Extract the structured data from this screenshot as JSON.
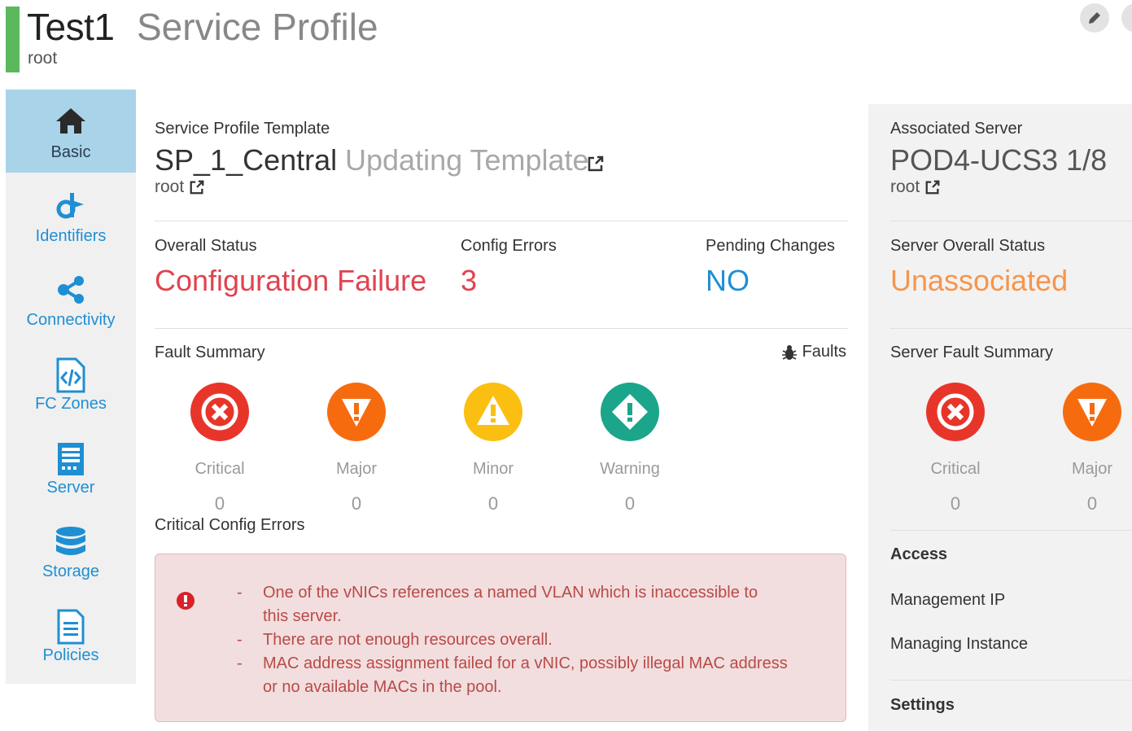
{
  "header": {
    "title": "Test1",
    "subtitle": "Service Profile",
    "org": "root",
    "edit_icon": "pencil-icon"
  },
  "sidebar": {
    "items": [
      {
        "label": "Basic",
        "icon": "home-icon",
        "active": true
      },
      {
        "label": "Identifiers",
        "icon": "identifiers-icon",
        "active": false
      },
      {
        "label": "Connectivity",
        "icon": "share-icon",
        "active": false
      },
      {
        "label": "FC Zones",
        "icon": "code-file-icon",
        "active": false
      },
      {
        "label": "Server",
        "icon": "server-icon",
        "active": false
      },
      {
        "label": "Storage",
        "icon": "database-icon",
        "active": false
      },
      {
        "label": "Policies",
        "icon": "document-icon",
        "active": false
      }
    ]
  },
  "template": {
    "label": "Service Profile Template",
    "name": "SP_1_Central",
    "type": "Updating Template",
    "org": "root"
  },
  "status": {
    "overall_label": "Overall Status",
    "overall_value": "Configuration Failure",
    "config_errors_label": "Config Errors",
    "config_errors_value": "3",
    "pending_label": "Pending Changes",
    "pending_value": "NO"
  },
  "fault_summary": {
    "label": "Fault Summary",
    "faults_link": "Faults",
    "items": [
      {
        "label": "Critical",
        "count": "0",
        "color": "#e8352a"
      },
      {
        "label": "Major",
        "count": "0",
        "color": "#f76b0f"
      },
      {
        "label": "Minor",
        "count": "0",
        "color": "#fbbf12"
      },
      {
        "label": "Warning",
        "count": "0",
        "color": "#1ba58b"
      }
    ]
  },
  "critical_errors": {
    "label": "Critical Config Errors",
    "lines": [
      "One of the vNICs references a named VLAN which is inaccessible to",
      "this server.",
      "There are not enough resources overall.",
      "MAC address assignment failed for a vNIC, possibly illegal MAC address",
      "or no available MACs in the pool."
    ],
    "dash": "-"
  },
  "right_panel": {
    "associated_label": "Associated Server",
    "server_name": "POD4-UCS3 1/8",
    "server_org": "root",
    "overall_status_label": "Server Overall Status",
    "overall_status_value": "Unassociated",
    "fault_label": "Server Fault Summary",
    "faults": [
      {
        "label": "Critical",
        "count": "0",
        "color": "#e8352a"
      },
      {
        "label": "Major",
        "count": "0",
        "color": "#f76b0f"
      }
    ],
    "access_label": "Access",
    "mgmt_ip_label": "Management IP",
    "managing_instance_label": "Managing Instance",
    "settings_label": "Settings"
  },
  "colors": {
    "accent_green": "#5cb85c",
    "link_blue": "#1f8fd3",
    "error_red": "#e0434f",
    "orange": "#f7954a",
    "active_nav": "#a9d3e9"
  }
}
